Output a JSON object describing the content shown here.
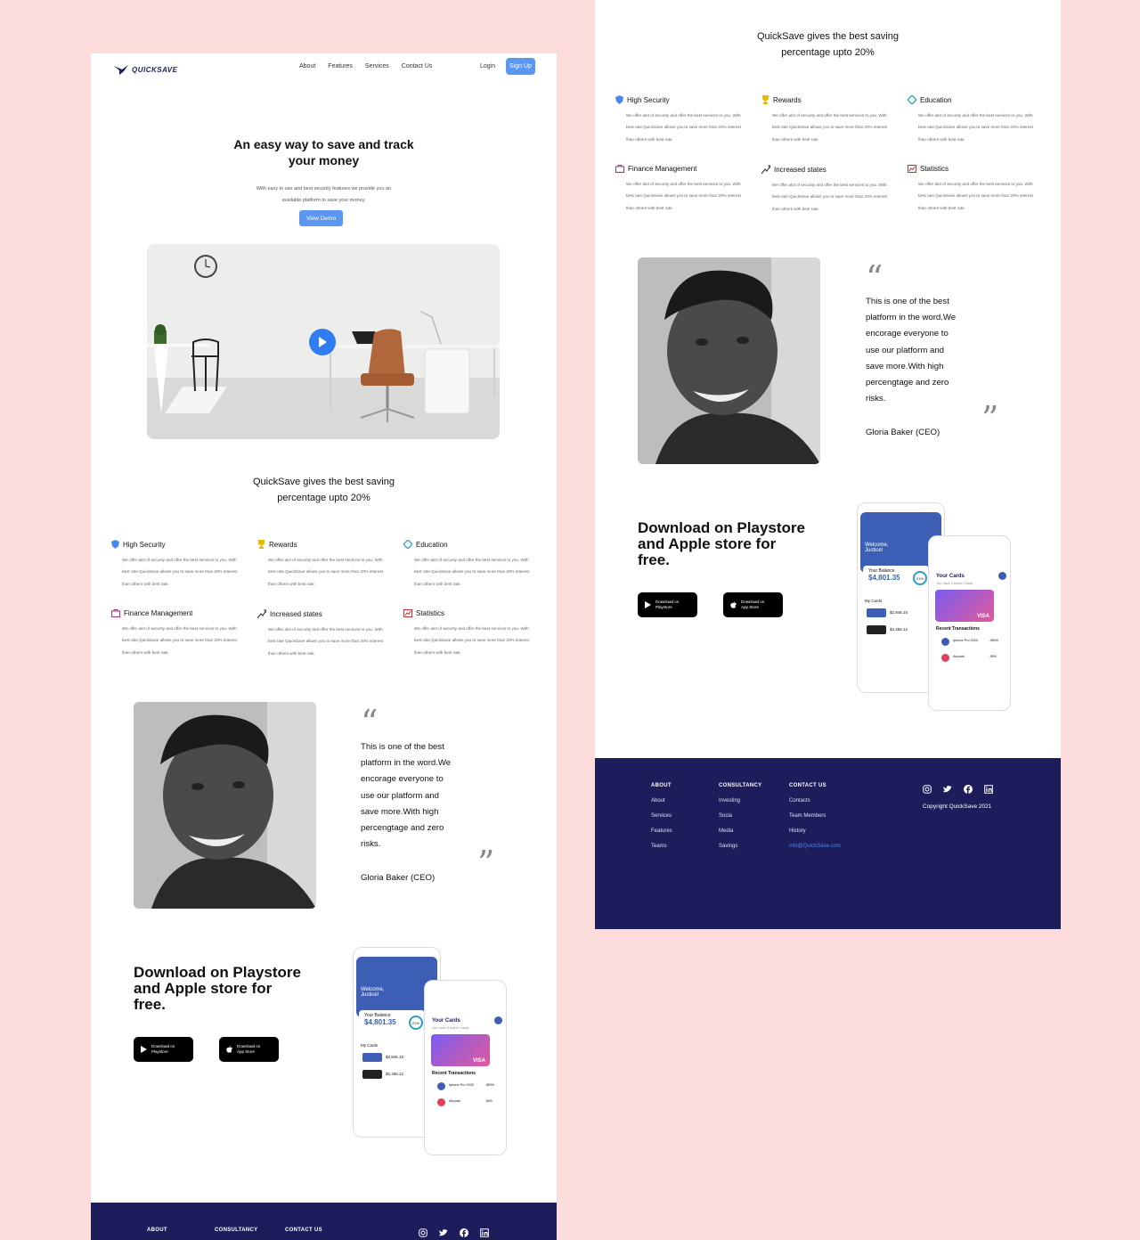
{
  "brand": {
    "name": "QUICKSAVE"
  },
  "nav": {
    "links": [
      "About",
      "Features",
      "Services",
      "Contact Us"
    ],
    "login": "Login",
    "signup": "Sign Up"
  },
  "hero": {
    "title_line1": "An easy way to save and track",
    "title_line2": "your money",
    "subtitle": "With easy to use and best security features we provide you an available platform to save your money.",
    "cta": "View Demo"
  },
  "benefits": {
    "title_line1": "QuickSave  gives the best saving",
    "title_line2": "percentage upto 20%"
  },
  "features": [
    {
      "title": "High Security",
      "icon": "shield-icon",
      "color": "#4a86f0",
      "desc": "We offer alot of security and offer the best services to you. With best rate QuickSave allows you to save more than 20% interest than others with best rate."
    },
    {
      "title": "Rewards",
      "icon": "trophy-icon",
      "color": "#e6b800",
      "desc": "We offer alot of security and offer the best services to you. With best rate QuickSave allows you to save more than 20% interest than others with best rate."
    },
    {
      "title": "Education",
      "icon": "diamond-icon",
      "color": "#2aa0c8",
      "desc": "We offer alot of security and offer the best services to you. With best rate QuickSave allows you to save more than 20% interest than others with best rate."
    },
    {
      "title": "Finance Management",
      "icon": "briefcase-icon",
      "color": "#a0307a",
      "desc": "We offer alot of security and offer the best services to you. With best rate QuickSave allows you to save more than 20% interest than others with best rate."
    },
    {
      "title": "Increased states",
      "icon": "trend-up-icon",
      "color": "#333333",
      "desc": "We offer alot of security and offer the best services to you. With best rate QuickSave allows you to save more than 20% interest than others with best rate."
    },
    {
      "title": "Statistics",
      "icon": "chart-icon",
      "color": "#c03030",
      "desc": "We offer alot of security and offer the best services to you. With best rate QuickSave allows you to save more than 20% interest than others with best rate."
    }
  ],
  "testimonial": {
    "lines": [
      "This is one of the best",
      "platform in the word.We",
      "encorage everyone to",
      "use our platform and",
      "save more.With high",
      "percengtage and zero",
      "risks."
    ],
    "author": "Gloria Baker (CEO)"
  },
  "download": {
    "title_line1": "Download on Playstore",
    "title_line2": "and Apple store for",
    "title_line3": "free.",
    "playstore": {
      "line1": "Download on",
      "line2": "Playstore"
    },
    "appstore": {
      "line1": "Download on",
      "line2": "App Store"
    }
  },
  "phone": {
    "welcome": "Welcome, Justice!",
    "balance_label": "Your Balance",
    "balance": "$4,801.35",
    "progress": "21%",
    "cards_title": "Your Cards",
    "cards_sub": "You have 3 Active Cards",
    "card_brand": "VISA",
    "recent": "Recent Transactions",
    "my_cards": "My Cards",
    "tx": [
      {
        "name": "Iphone Pro 2020",
        "amount": "-$999"
      },
      {
        "name": "Airpods",
        "amount": "-$99"
      }
    ],
    "card_rows": [
      {
        "amount": "$2,946.15"
      },
      {
        "amount": "$2,456.12"
      }
    ]
  },
  "footer": {
    "about": {
      "title": "ABOUT",
      "items": [
        "About",
        "Services",
        "Features",
        "Teams"
      ]
    },
    "consultancy": {
      "title": "CONSULTANCY",
      "items": [
        "Investing",
        "Socia",
        "Media",
        "Savings"
      ]
    },
    "contact": {
      "title": "CONTACT US",
      "items": [
        "Contacts",
        "Team Members",
        "History"
      ],
      "email": "info@QuickSave.com"
    },
    "social": [
      "instagram-icon",
      "twitter-icon",
      "facebook-icon",
      "linkedin-icon"
    ],
    "copyright": "Copyright QuickSave 2021"
  }
}
